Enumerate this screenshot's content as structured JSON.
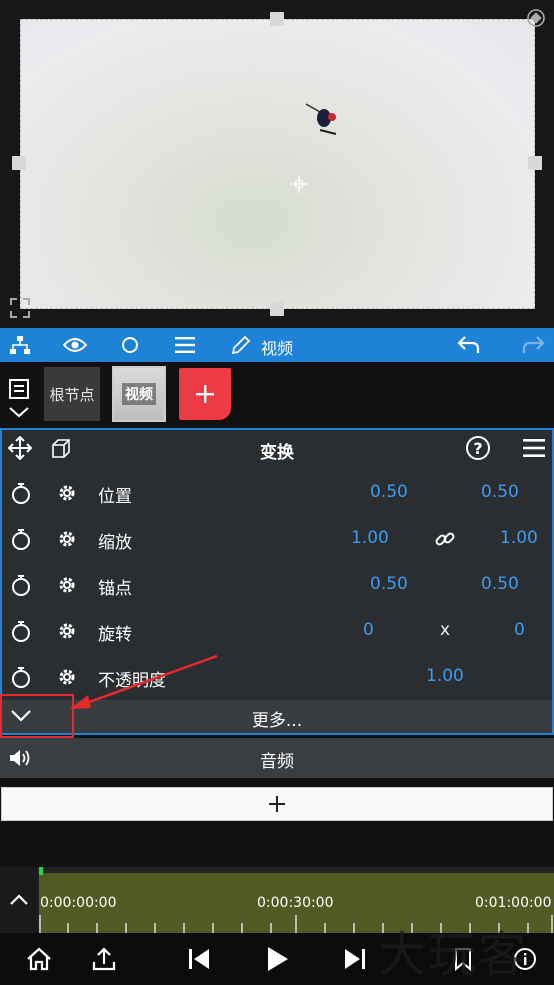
{
  "toolbar": {
    "layer_label": "视频"
  },
  "nodes": {
    "root_label": "根节点",
    "video_label": "视频"
  },
  "panel": {
    "title": "变换",
    "rows": [
      {
        "label": "位置",
        "v1": "0.50",
        "sep": "",
        "v2": "0.50"
      },
      {
        "label": "缩放",
        "v1": "1.00",
        "sep": "link",
        "v2": "1.00"
      },
      {
        "label": "锚点",
        "v1": "0.50",
        "sep": "",
        "v2": "0.50"
      },
      {
        "label": "旋转",
        "v1": "0",
        "sep": "x",
        "v2": "0"
      },
      {
        "label": "不透明度",
        "v1": "1.00",
        "sep": "",
        "v2": ""
      }
    ],
    "more_label": "更多..."
  },
  "audio": {
    "label": "音频"
  },
  "timeline": {
    "tc_start": "0:00:00:00",
    "tc_mid": "0:00:30:00",
    "tc_end": "0:01:00:00"
  },
  "watermark": "大玩客",
  "colors": {
    "accent": "#1e82d7",
    "value_blue": "#3d9bf0",
    "add_red": "#ee3a43",
    "track_green": "#505a22",
    "annotation_red": "#e42b2b"
  }
}
